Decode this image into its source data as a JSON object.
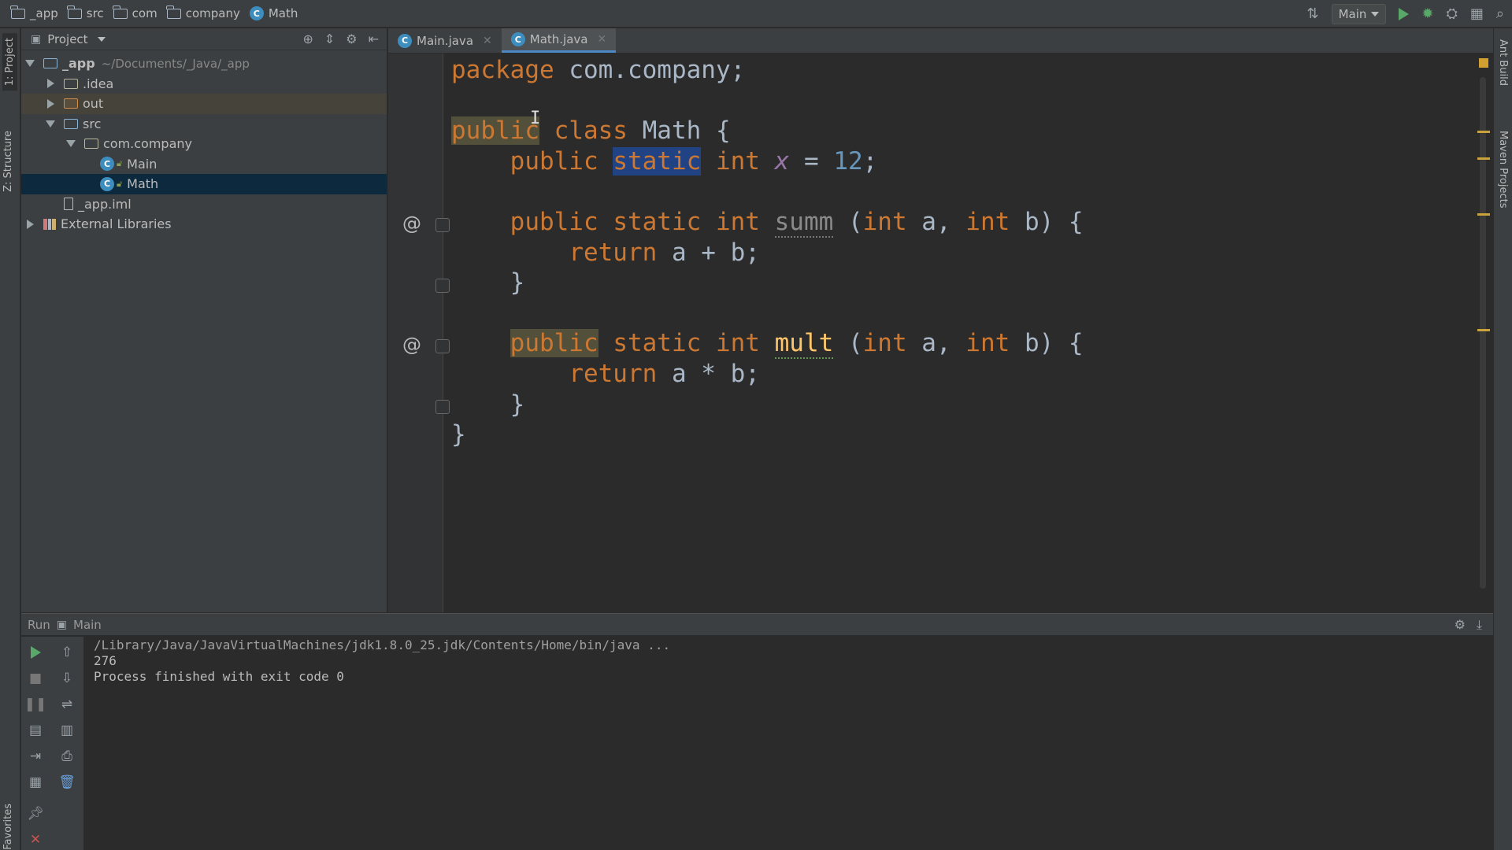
{
  "navbar": {
    "crumbs": [
      {
        "label": "_app",
        "icon": "folder-icon"
      },
      {
        "label": "src",
        "icon": "folder-icon"
      },
      {
        "label": "com",
        "icon": "folder-icon"
      },
      {
        "label": "company",
        "icon": "folder-icon"
      },
      {
        "label": "Math",
        "icon": "class-icon"
      }
    ],
    "run_config": "Main"
  },
  "left_stripe": {
    "project_tab": "1: Project",
    "structure_tab": "Z: Structure",
    "favorites_tab": "Favorites"
  },
  "right_stripe": {
    "ant_tab": "Ant Build",
    "maven_tab": "Maven Projects"
  },
  "project": {
    "title": "Project",
    "tree": [
      {
        "label": "_app",
        "suffix": "~/Documents/_Java/_app"
      },
      {
        "label": ".idea"
      },
      {
        "label": "out"
      },
      {
        "label": "src"
      },
      {
        "label": "com.company"
      },
      {
        "label": "Main"
      },
      {
        "label": "Math"
      },
      {
        "label": "_app.iml"
      },
      {
        "label": "External Libraries"
      }
    ]
  },
  "tabs": [
    {
      "label": "Main.java"
    },
    {
      "label": "Math.java",
      "active": true
    }
  ],
  "code": {
    "l1": {
      "kw": "package",
      "rest": " com.company;"
    },
    "l3": {
      "kw1": "public",
      "kw2": "class",
      "rest": " Math {"
    },
    "l4": {
      "kw1": "public",
      "kw2": "static",
      "kw3": "int",
      "field": "x",
      "op": " = ",
      "num": "12",
      "end": ";"
    },
    "l6": {
      "kw1": "public",
      "kw2": "static",
      "kw3": "int",
      "name": "summ",
      "p1": "int",
      "a": " a, ",
      "p2": "int",
      "b": " b) {"
    },
    "l7": {
      "kw": "return",
      "rest": " a + b;"
    },
    "l8": "}",
    "l10": {
      "kw1": "public",
      "kw2": "static",
      "kw3": "int",
      "name": "mult",
      "p1": "int",
      "a": " a, ",
      "p2": "int",
      "b": " b) {"
    },
    "l11": {
      "kw": "return",
      "rest": " a * b;"
    },
    "l12": "}",
    "l13": "}",
    "override_marker": "@"
  },
  "run": {
    "label": "Run",
    "config": "Main",
    "output": [
      "/Library/Java/JavaVirtualMachines/jdk1.8.0_25.jdk/Contents/Home/bin/java ...",
      "276",
      "Process finished with exit code 0"
    ]
  },
  "colors": {
    "keyword": "#cc7832",
    "number": "#6897bb",
    "field": "#9876aa",
    "method": "#ffc66d",
    "selection": "#214283",
    "run_green": "#59a869"
  }
}
